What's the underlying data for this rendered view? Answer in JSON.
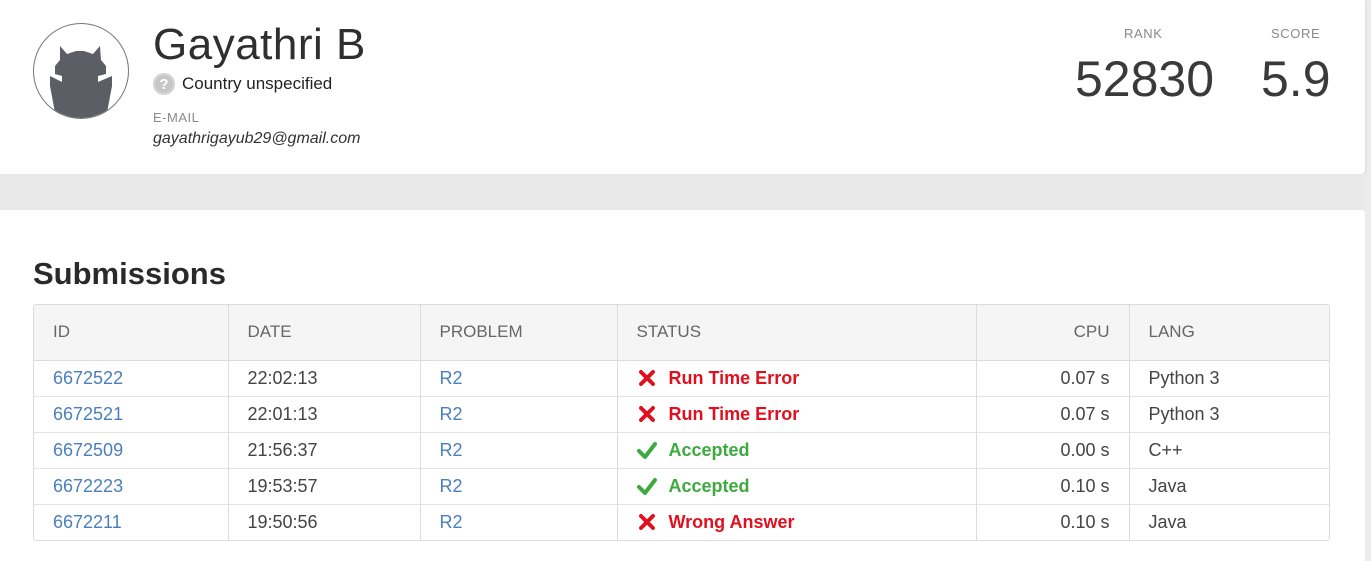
{
  "profile": {
    "name": "Gayathri B",
    "country": "Country unspecified",
    "email_label": "E-MAIL",
    "email": "gayathrigayub29@gmail.com",
    "rank_label": "RANK",
    "rank": "52830",
    "score_label": "SCORE",
    "score": "5.9"
  },
  "submissions": {
    "title": "Submissions",
    "columns": [
      "ID",
      "DATE",
      "PROBLEM",
      "STATUS",
      "CPU",
      "LANG"
    ],
    "rows": [
      {
        "id": "6672522",
        "date": "22:02:13",
        "problem": "R2",
        "status": "Run Time Error",
        "status_type": "error",
        "cpu": "0.07 s",
        "lang": "Python 3"
      },
      {
        "id": "6672521",
        "date": "22:01:13",
        "problem": "R2",
        "status": "Run Time Error",
        "status_type": "error",
        "cpu": "0.07 s",
        "lang": "Python 3"
      },
      {
        "id": "6672509",
        "date": "21:56:37",
        "problem": "R2",
        "status": "Accepted",
        "status_type": "accepted",
        "cpu": "0.00 s",
        "lang": "C++"
      },
      {
        "id": "6672223",
        "date": "19:53:57",
        "problem": "R2",
        "status": "Accepted",
        "status_type": "accepted",
        "cpu": "0.10 s",
        "lang": "Java"
      },
      {
        "id": "6672211",
        "date": "19:50:56",
        "problem": "R2",
        "status": "Wrong Answer",
        "status_type": "error",
        "cpu": "0.10 s",
        "lang": "Java"
      }
    ]
  },
  "colors": {
    "error": "#e0101e",
    "accepted": "#3daa3d",
    "link": "#4a7fbf"
  }
}
